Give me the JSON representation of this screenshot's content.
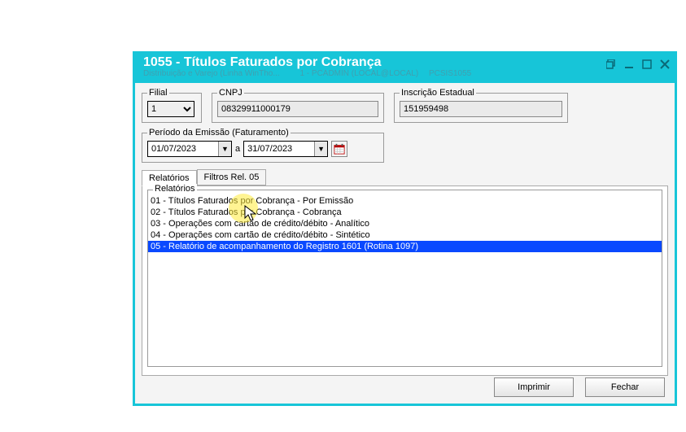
{
  "titlebar": {
    "title": "1055 - Títulos Faturados por Cobrança",
    "sub_left": "Distribuição e Varejo (Linha WinTho...",
    "sub_mid": "1 - PCADMIN (LOCAL@LOCAL)",
    "sub_right": "PCSIS1055"
  },
  "filters": {
    "filial_label": "Filial",
    "filial_value": "1",
    "cnpj_label": "CNPJ",
    "cnpj_value": "08329911000179",
    "insc_label": "Inscrição Estadual",
    "insc_value": "151959498",
    "periodo_label": "Período da Emissão (Faturamento)",
    "date_from": "01/07/2023",
    "date_sep": "a",
    "date_to": "31/07/2023"
  },
  "tabs": {
    "t0": "Relatórios",
    "t1": "Filtros Rel. 05",
    "group_label": "Relatórios"
  },
  "reports": {
    "r0": "01 - Títulos Faturados por Cobrança - Por Emissão",
    "r1": "02 - Títulos Faturados por Cobrança - Cobrança",
    "r2": "03 - Operações com cartão de crédito/débito - Analítico",
    "r3": "04 - Operações com cartão de crédito/débito - Sintético",
    "r4": "05 - Relatório de acompanhamento do Registro 1601 (Rotina 1097)"
  },
  "buttons": {
    "print": "Imprimir",
    "close": "Fechar"
  }
}
